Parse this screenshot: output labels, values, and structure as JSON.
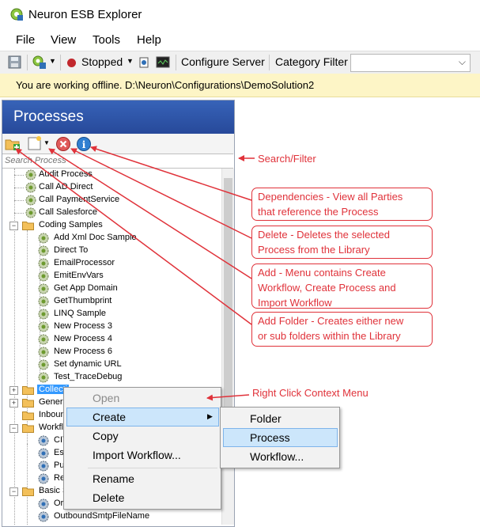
{
  "window": {
    "title": "Neuron ESB Explorer"
  },
  "menu": [
    "File",
    "View",
    "Tools",
    "Help"
  ],
  "toolbar": {
    "status_label": "Stopped",
    "configure_server": "Configure Server",
    "category_filter_label": "Category Filter",
    "category_filter_value": ""
  },
  "offline_message": "You are working offline. D:\\Neuron\\Configurations\\DemoSolution2",
  "panel": {
    "title": "Processes",
    "search_placeholder": "Search Process"
  },
  "tree": {
    "root_items": [
      "Audit Process",
      "Call AD Direct",
      "Call PaymentService",
      "Call Salesforce"
    ],
    "coding_samples_folder": "Coding Samples",
    "coding_samples": [
      "Add Xml Doc Sample",
      "Direct To",
      "EmailProcessor",
      "EmitEnvVars",
      "Get App Domain",
      "GetThumbprint",
      "LINQ Sample",
      "New Process 3",
      "New Process 4",
      "New Process 6",
      "Set dynamic URL",
      "Test_TraceDebug"
    ],
    "folders_partial": [
      "Collecti",
      "Generic",
      "Inboun",
      "Workflo"
    ],
    "workflow_children_partial": [
      "CIT",
      "Esc",
      "Pur",
      "Rec"
    ],
    "basic_folder_partial": "Basic S",
    "basic_children": [
      "Ord",
      "OutboundSmtpFileName"
    ]
  },
  "context_menu": {
    "open": "Open",
    "create": "Create",
    "copy": "Copy",
    "import_workflow": "Import Workflow...",
    "rename": "Rename",
    "delete": "Delete"
  },
  "submenu": {
    "folder": "Folder",
    "process": "Process",
    "workflow": "Workflow..."
  },
  "annotations": {
    "search_filter": "Search/Filter",
    "dependencies": [
      "Dependencies - View all Parties",
      "that reference the Process"
    ],
    "delete": [
      "Delete - Deletes the selected",
      "Process from the Library"
    ],
    "add": [
      "Add - Menu contains Create",
      "Workflow, Create Process and",
      "Import Workflow"
    ],
    "add_folder": [
      "Add Folder - Creates either new",
      "or sub folders within the Library"
    ],
    "right_click": "Right Click Context Menu"
  },
  "colors": {
    "annotation_red": "#e0323a",
    "panel_header": "#3763b8",
    "offline_bar": "#fdf5c6"
  }
}
